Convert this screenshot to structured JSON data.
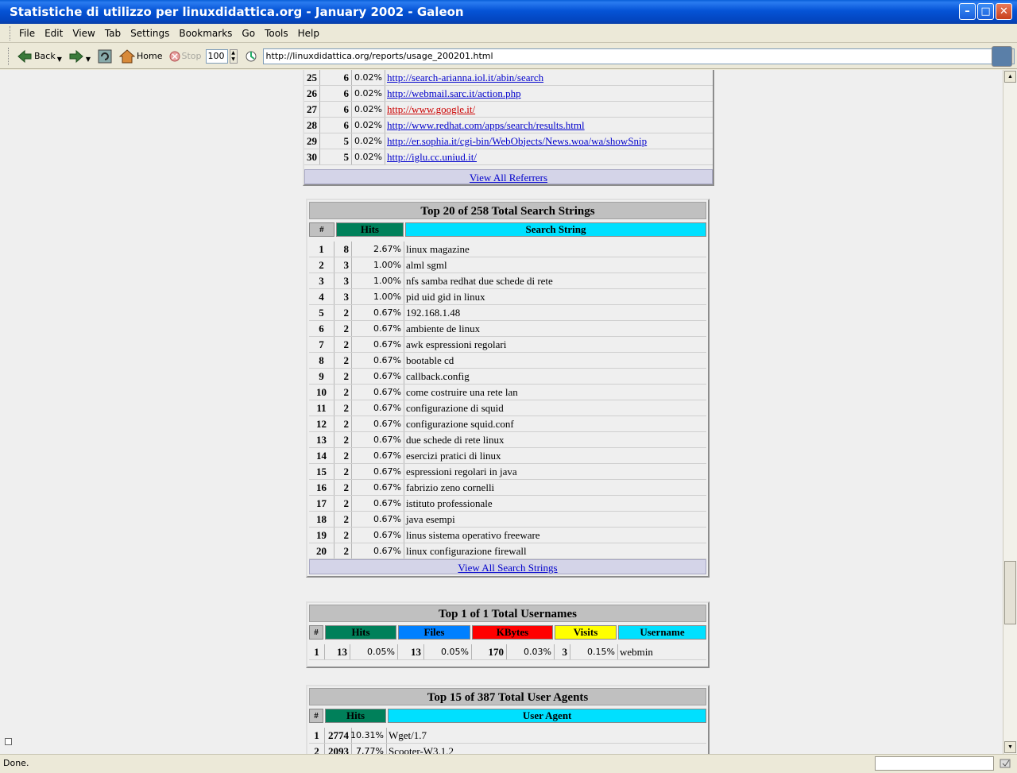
{
  "window": {
    "title": "Statistiche di utilizzo per linuxdidattica.org - January 2002 - Galeon",
    "min_icon": "minimize-icon",
    "max_icon": "maximize-icon",
    "close_icon": "close-icon"
  },
  "menu": [
    "File",
    "Edit",
    "View",
    "Tab",
    "Settings",
    "Bookmarks",
    "Go",
    "Tools",
    "Help"
  ],
  "toolbar": {
    "back_label": "Back",
    "home_label": "Home",
    "stop_label": "Stop",
    "zoom_value": "100",
    "url": "http://linuxdidattica.org/reports/usage_200201.html"
  },
  "referrers": {
    "rows": [
      {
        "num": "25",
        "hits": "6",
        "pct": "0.02%",
        "url": "http://search-arianna.iol.it/abin/search",
        "visited": false
      },
      {
        "num": "26",
        "hits": "6",
        "pct": "0.02%",
        "url": "http://webmail.sarc.it/action.php",
        "visited": false
      },
      {
        "num": "27",
        "hits": "6",
        "pct": "0.02%",
        "url": "http://www.google.it/",
        "visited": true
      },
      {
        "num": "28",
        "hits": "6",
        "pct": "0.02%",
        "url": "http://www.redhat.com/apps/search/results.html",
        "visited": false
      },
      {
        "num": "29",
        "hits": "5",
        "pct": "0.02%",
        "url": "http://er.sophia.it/cgi-bin/WebObjects/News.woa/wa/showSnip",
        "visited": false
      },
      {
        "num": "30",
        "hits": "5",
        "pct": "0.02%",
        "url": "http://iglu.cc.uniud.it/",
        "visited": false
      }
    ],
    "footer": "View All Referrers"
  },
  "search": {
    "title": "Top 20 of 258 Total Search Strings",
    "col_hash": "#",
    "col_hits": "Hits",
    "col_string": "Search String",
    "rows": [
      {
        "num": "1",
        "hits": "8",
        "pct": "2.67%",
        "text": "linux magazine"
      },
      {
        "num": "2",
        "hits": "3",
        "pct": "1.00%",
        "text": "alml sgml"
      },
      {
        "num": "3",
        "hits": "3",
        "pct": "1.00%",
        "text": "nfs samba redhat due schede di rete"
      },
      {
        "num": "4",
        "hits": "3",
        "pct": "1.00%",
        "text": "pid uid gid in linux"
      },
      {
        "num": "5",
        "hits": "2",
        "pct": "0.67%",
        "text": "192.168.1.48"
      },
      {
        "num": "6",
        "hits": "2",
        "pct": "0.67%",
        "text": "ambiente de linux"
      },
      {
        "num": "7",
        "hits": "2",
        "pct": "0.67%",
        "text": "awk espressioni regolari"
      },
      {
        "num": "8",
        "hits": "2",
        "pct": "0.67%",
        "text": "bootable cd"
      },
      {
        "num": "9",
        "hits": "2",
        "pct": "0.67%",
        "text": "callback.config"
      },
      {
        "num": "10",
        "hits": "2",
        "pct": "0.67%",
        "text": "come costruire una rete lan"
      },
      {
        "num": "11",
        "hits": "2",
        "pct": "0.67%",
        "text": "configurazione di squid"
      },
      {
        "num": "12",
        "hits": "2",
        "pct": "0.67%",
        "text": "configurazione squid.conf"
      },
      {
        "num": "13",
        "hits": "2",
        "pct": "0.67%",
        "text": "due schede di rete linux"
      },
      {
        "num": "14",
        "hits": "2",
        "pct": "0.67%",
        "text": "esercizi pratici di linux"
      },
      {
        "num": "15",
        "hits": "2",
        "pct": "0.67%",
        "text": "espressioni regolari in java"
      },
      {
        "num": "16",
        "hits": "2",
        "pct": "0.67%",
        "text": "fabrizio zeno cornelli"
      },
      {
        "num": "17",
        "hits": "2",
        "pct": "0.67%",
        "text": "istituto professionale"
      },
      {
        "num": "18",
        "hits": "2",
        "pct": "0.67%",
        "text": "java esempi"
      },
      {
        "num": "19",
        "hits": "2",
        "pct": "0.67%",
        "text": "linus sistema operativo freeware"
      },
      {
        "num": "20",
        "hits": "2",
        "pct": "0.67%",
        "text": "linux configurazione firewall"
      }
    ],
    "footer": "View All Search Strings"
  },
  "users": {
    "title": "Top 1 of 1 Total Usernames",
    "cols": [
      "#",
      "Hits",
      "Files",
      "KBytes",
      "Visits",
      "Username"
    ],
    "row": {
      "num": "1",
      "hits": "13",
      "hits_pct": "0.05%",
      "files": "13",
      "files_pct": "0.05%",
      "kb": "170",
      "kb_pct": "0.03%",
      "visits": "3",
      "visits_pct": "0.15%",
      "name": "webmin"
    }
  },
  "agents": {
    "title": "Top 15 of 387 Total User Agents",
    "col_hash": "#",
    "col_hits": "Hits",
    "col_agent": "User Agent",
    "rows": [
      {
        "num": "1",
        "hits": "2774",
        "pct": "10.31%",
        "text": "Wget/1.7"
      },
      {
        "num": "2",
        "hits": "2093",
        "pct": "7.77%",
        "text": "Scooter-W3.1.2"
      }
    ]
  },
  "status": {
    "text": "Done."
  }
}
